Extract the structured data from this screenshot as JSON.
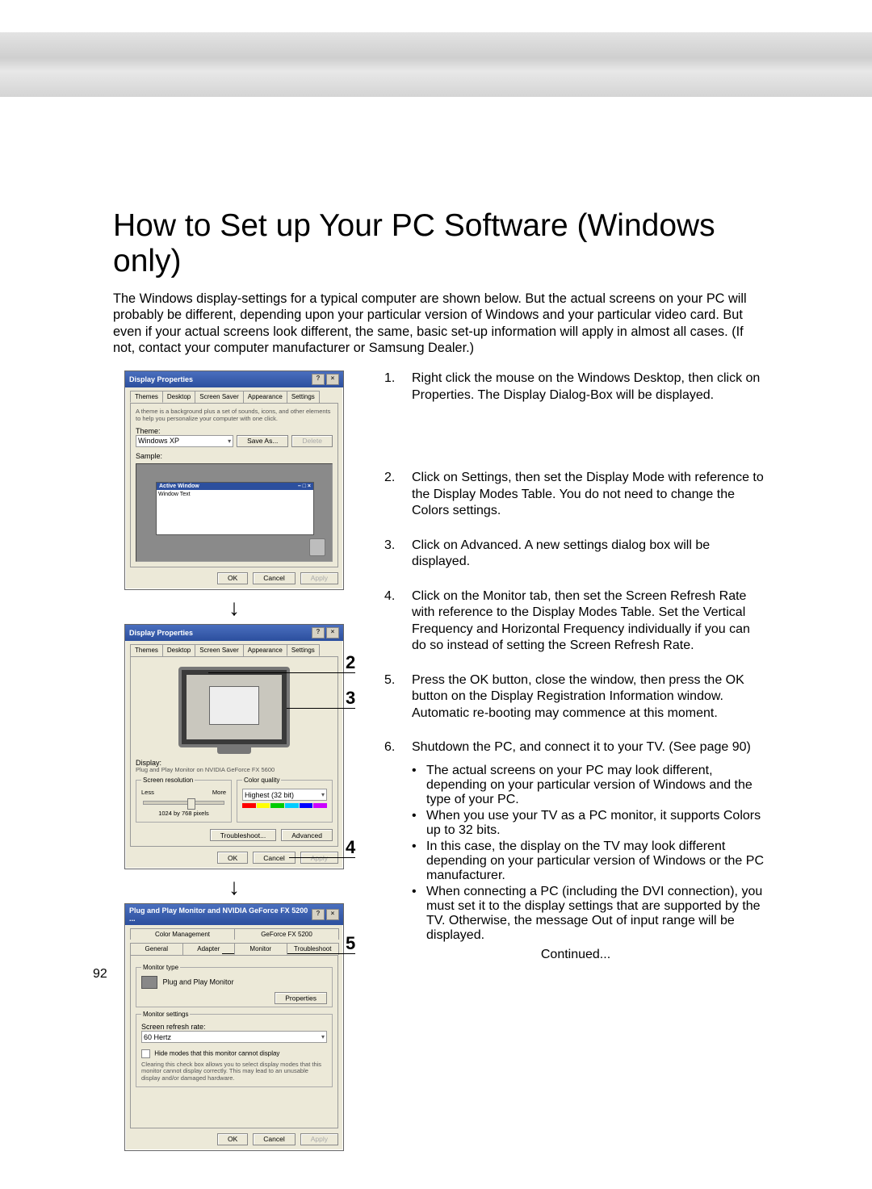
{
  "page_number": "92",
  "title": "How to Set up Your PC Software (Windows only)",
  "intro": "The Windows display-settings for a typical computer are shown below. But the actual screens on your PC will probably be different, depending upon your particular version of Windows and your particular video card. But even if your actual screens look different, the same, basic set-up information will apply in almost all cases. (If not, contact your computer manufacturer or Samsung Dealer.)",
  "steps": [
    {
      "n": "1.",
      "body": "Right click the mouse on the Windows Desktop, then click on Properties. The Display Dialog-Box will be displayed."
    },
    {
      "n": "2.",
      "body": "Click on Settings, then set the Display Mode with reference to the Display Modes Table. You do not need to change the Colors settings."
    },
    {
      "n": "3.",
      "body": "Click on Advanced. A new settings dialog box will be displayed."
    },
    {
      "n": "4.",
      "body": "Click on the Monitor tab, then set the Screen Refresh Rate with reference to the Display Modes Table. Set the Vertical Frequency and Horizontal Frequency individually if you can do so instead of setting the Screen Refresh Rate."
    },
    {
      "n": "5.",
      "body": "Press the OK button, close the window, then press the OK button on the Display Registration Information window. Automatic re-booting may commence at this moment."
    },
    {
      "n": "6.",
      "body": "Shutdown the PC, and connect it to your TV. (See page 90)"
    }
  ],
  "bullets": [
    "The actual screens on your PC may look different, depending on your particular version of Windows and the type of your PC.",
    "When you use your TV as a PC monitor, it supports Colors up to 32 bits.",
    "In this case, the display on the TV may look different depending on your particular version of Windows or the PC manufacturer.",
    "When connecting a PC (including the DVI connection), you must set it to the display settings that are supported by the TV. Otherwise, the message Out of input range will be displayed."
  ],
  "continued": "Continued...",
  "markers": {
    "m2": "2",
    "m3": "3",
    "m4": "4",
    "m5": "5"
  },
  "dlg1": {
    "title": "Display Properties",
    "tabs": [
      "Themes",
      "Desktop",
      "Screen Saver",
      "Appearance",
      "Settings"
    ],
    "desc": "A theme is a background plus a set of sounds, icons, and other elements to help you personalize your computer with one click.",
    "theme_label": "Theme:",
    "theme_value": "Windows XP",
    "sample_label": "Sample:",
    "active_window": "Active Window",
    "window_text": "Window Text",
    "save_as": "Save As...",
    "delete": "Delete",
    "ok": "OK",
    "cancel": "Cancel",
    "apply": "Apply"
  },
  "dlg2": {
    "title": "Display Properties",
    "tabs": [
      "Themes",
      "Desktop",
      "Screen Saver",
      "Appearance",
      "Settings"
    ],
    "display_label": "Display:",
    "display_value": "Plug and Play Monitor on NVIDIA GeForce FX 5600",
    "res_legend": "Screen resolution",
    "less": "Less",
    "more": "More",
    "res_value": "1024 by 768 pixels",
    "cq_legend": "Color quality",
    "cq_value": "Highest (32 bit)",
    "troubleshoot": "Troubleshoot...",
    "advanced": "Advanced",
    "ok": "OK",
    "cancel": "Cancel",
    "apply": "Apply"
  },
  "dlg3": {
    "title": "Plug and Play Monitor and NVIDIA GeForce FX 5200 ...",
    "tabs_row1": [
      "Color Management",
      "GeForce FX 5200"
    ],
    "tabs_row2": [
      "General",
      "Adapter",
      "Monitor",
      "Troubleshoot"
    ],
    "mt_legend": "Monitor type",
    "mt_value": "Plug and Play Monitor",
    "properties": "Properties",
    "ms_legend": "Monitor settings",
    "refresh_label": "Screen refresh rate:",
    "refresh_value": "60 Hertz",
    "hide": "Hide modes that this monitor cannot display",
    "hide_desc": "Clearing this check box allows you to select display modes that this monitor cannot display correctly. This may lead to an unusable display and/or damaged hardware.",
    "ok": "OK",
    "cancel": "Cancel",
    "apply": "Apply"
  }
}
